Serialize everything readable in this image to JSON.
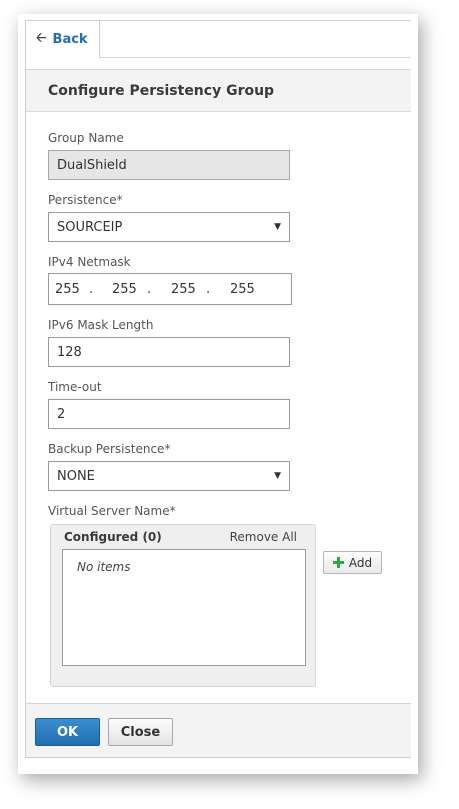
{
  "back": {
    "label": "Back",
    "icon": "arrow-left-icon"
  },
  "header": {
    "title": "Configure Persistency Group"
  },
  "fields": {
    "group_name": {
      "label": "Group Name",
      "value": "DualShield"
    },
    "persistence": {
      "label": "Persistence*",
      "value": "SOURCEIP"
    },
    "ipv4_netmask": {
      "label": "IPv4 Netmask",
      "octets": [
        "255",
        "255",
        "255",
        "255"
      ],
      "separator": "."
    },
    "ipv6_mask_length": {
      "label": "IPv6 Mask Length",
      "value": "128"
    },
    "timeout": {
      "label": "Time-out",
      "value": "2"
    },
    "backup_persistence": {
      "label": "Backup Persistence*",
      "value": "NONE"
    },
    "virtual_server_name": {
      "label": "Virtual Server Name*",
      "configured_label": "Configured (0)",
      "remove_all_label": "Remove All",
      "empty_text": "No items",
      "add_label": "Add"
    }
  },
  "footer": {
    "ok_label": "OK",
    "close_label": "Close"
  },
  "colors": {
    "primary": "#1f6eb0",
    "link": "#2070b0",
    "add_icon": "#2ea84a"
  }
}
